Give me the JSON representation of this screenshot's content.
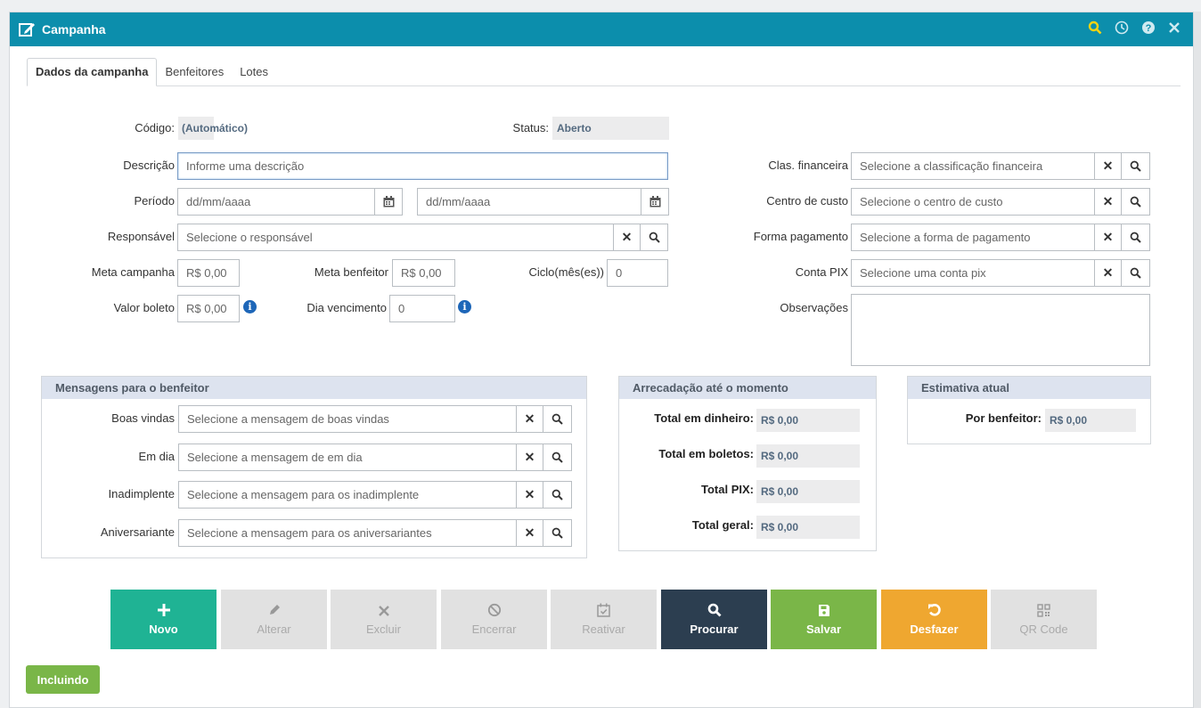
{
  "window": {
    "title": "Campanha"
  },
  "tabs": [
    {
      "label": "Dados da campanha"
    },
    {
      "label": "Benfeitores"
    },
    {
      "label": "Lotes"
    }
  ],
  "form": {
    "codigo_label": "Código:",
    "codigo_value": "(Automático)",
    "status_label": "Status:",
    "status_value": "Aberto",
    "descricao_label": "Descrição",
    "descricao_placeholder": "Informe uma descrição",
    "periodo_label": "Período",
    "date_placeholder": "dd/mm/aaaa",
    "responsavel_label": "Responsável",
    "responsavel_placeholder": "Selecione o responsável",
    "meta_campanha_label": "Meta campanha",
    "meta_campanha_value": "R$ 0,00",
    "meta_benfeitor_label": "Meta benfeitor",
    "meta_benfeitor_value": "R$ 0,00",
    "ciclo_label": "Ciclo(mês(es))",
    "ciclo_value": "0",
    "valor_boleto_label": "Valor boleto",
    "valor_boleto_value": "R$ 0,00",
    "dia_vencimento_label": "Dia vencimento",
    "dia_vencimento_value": "0",
    "clas_label": "Clas. financeira",
    "clas_placeholder": "Selecione a classificação financeira",
    "centro_label": "Centro de custo",
    "centro_placeholder": "Selecione o centro de custo",
    "forma_label": "Forma pagamento",
    "forma_placeholder": "Selecione a forma de pagamento",
    "pix_label": "Conta PIX",
    "pix_placeholder": "Selecione uma conta pix",
    "obs_label": "Observações"
  },
  "mensagens": {
    "title": "Mensagens para o benfeitor",
    "rows": [
      {
        "label": "Boas vindas",
        "placeholder": "Selecione a mensagem de boas vindas"
      },
      {
        "label": "Em dia",
        "placeholder": "Selecione a mensagem de em dia"
      },
      {
        "label": "Inadimplente",
        "placeholder": "Selecione a mensagem para os inadimplente"
      },
      {
        "label": "Aniversariante",
        "placeholder": "Selecione a mensagem para os aniversariantes"
      }
    ]
  },
  "arrecadacao": {
    "title": "Arrecadação até o momento",
    "rows": [
      {
        "label": "Total em dinheiro:",
        "value": "R$ 0,00"
      },
      {
        "label": "Total em boletos:",
        "value": "R$ 0,00"
      },
      {
        "label": "Total PIX:",
        "value": "R$ 0,00"
      },
      {
        "label": "Total geral:",
        "value": "R$ 0,00"
      }
    ]
  },
  "estimativa": {
    "title": "Estimativa atual",
    "label": "Por benfeitor:",
    "value": "R$ 0,00"
  },
  "actions": [
    {
      "label": "Novo",
      "icon": "plus-icon",
      "color": "#1fb394",
      "enabled": true
    },
    {
      "label": "Alterar",
      "icon": "pencil-icon",
      "enabled": false
    },
    {
      "label": "Excluir",
      "icon": "times-icon",
      "enabled": false
    },
    {
      "label": "Encerrar",
      "icon": "ban-icon",
      "enabled": false
    },
    {
      "label": "Reativar",
      "icon": "calendar-check-icon",
      "enabled": false
    },
    {
      "label": "Procurar",
      "icon": "search-icon",
      "color": "#2c3e50",
      "enabled": true
    },
    {
      "label": "Salvar",
      "icon": "save-icon",
      "color": "#7ab648",
      "enabled": true
    },
    {
      "label": "Desfazer",
      "icon": "undo-icon",
      "color": "#efa730",
      "enabled": true
    },
    {
      "label": "QR Code",
      "icon": "qrcode-icon",
      "enabled": false
    }
  ],
  "status_badge": "Incluindo",
  "colors": {
    "titlebar": "#0c8eac",
    "search_icon": "#f5d312"
  }
}
